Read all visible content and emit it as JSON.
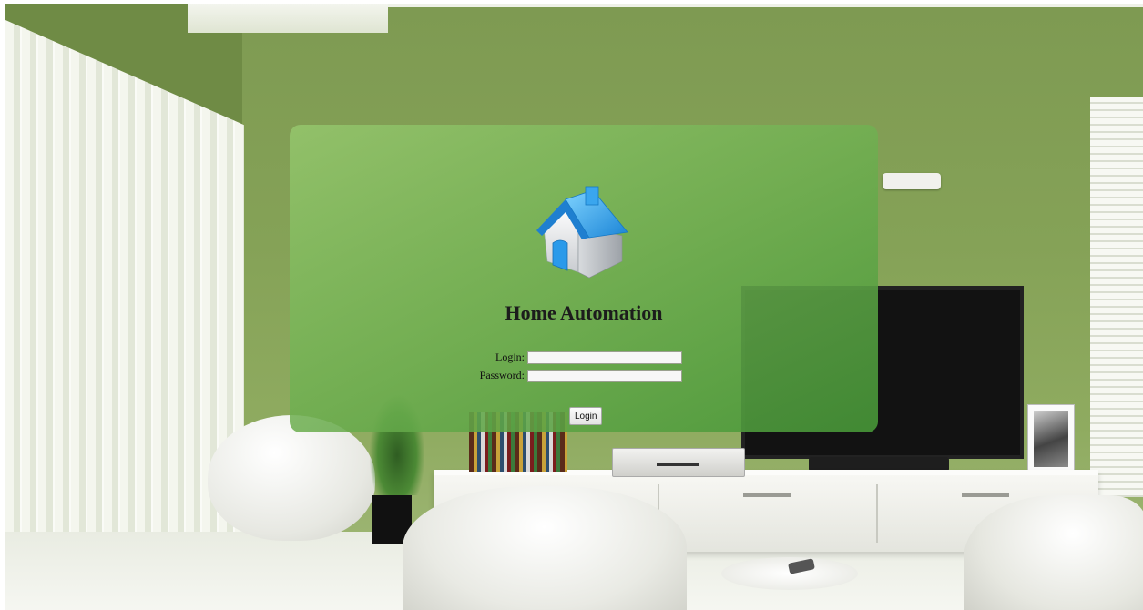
{
  "app": {
    "title": "Home Automation",
    "logo_icon": "house-icon",
    "accent_color": "#6aa84f"
  },
  "login_form": {
    "login_label": "Login:",
    "login_value": "",
    "password_label": "Password:",
    "password_value": "",
    "submit_label": "Login"
  }
}
